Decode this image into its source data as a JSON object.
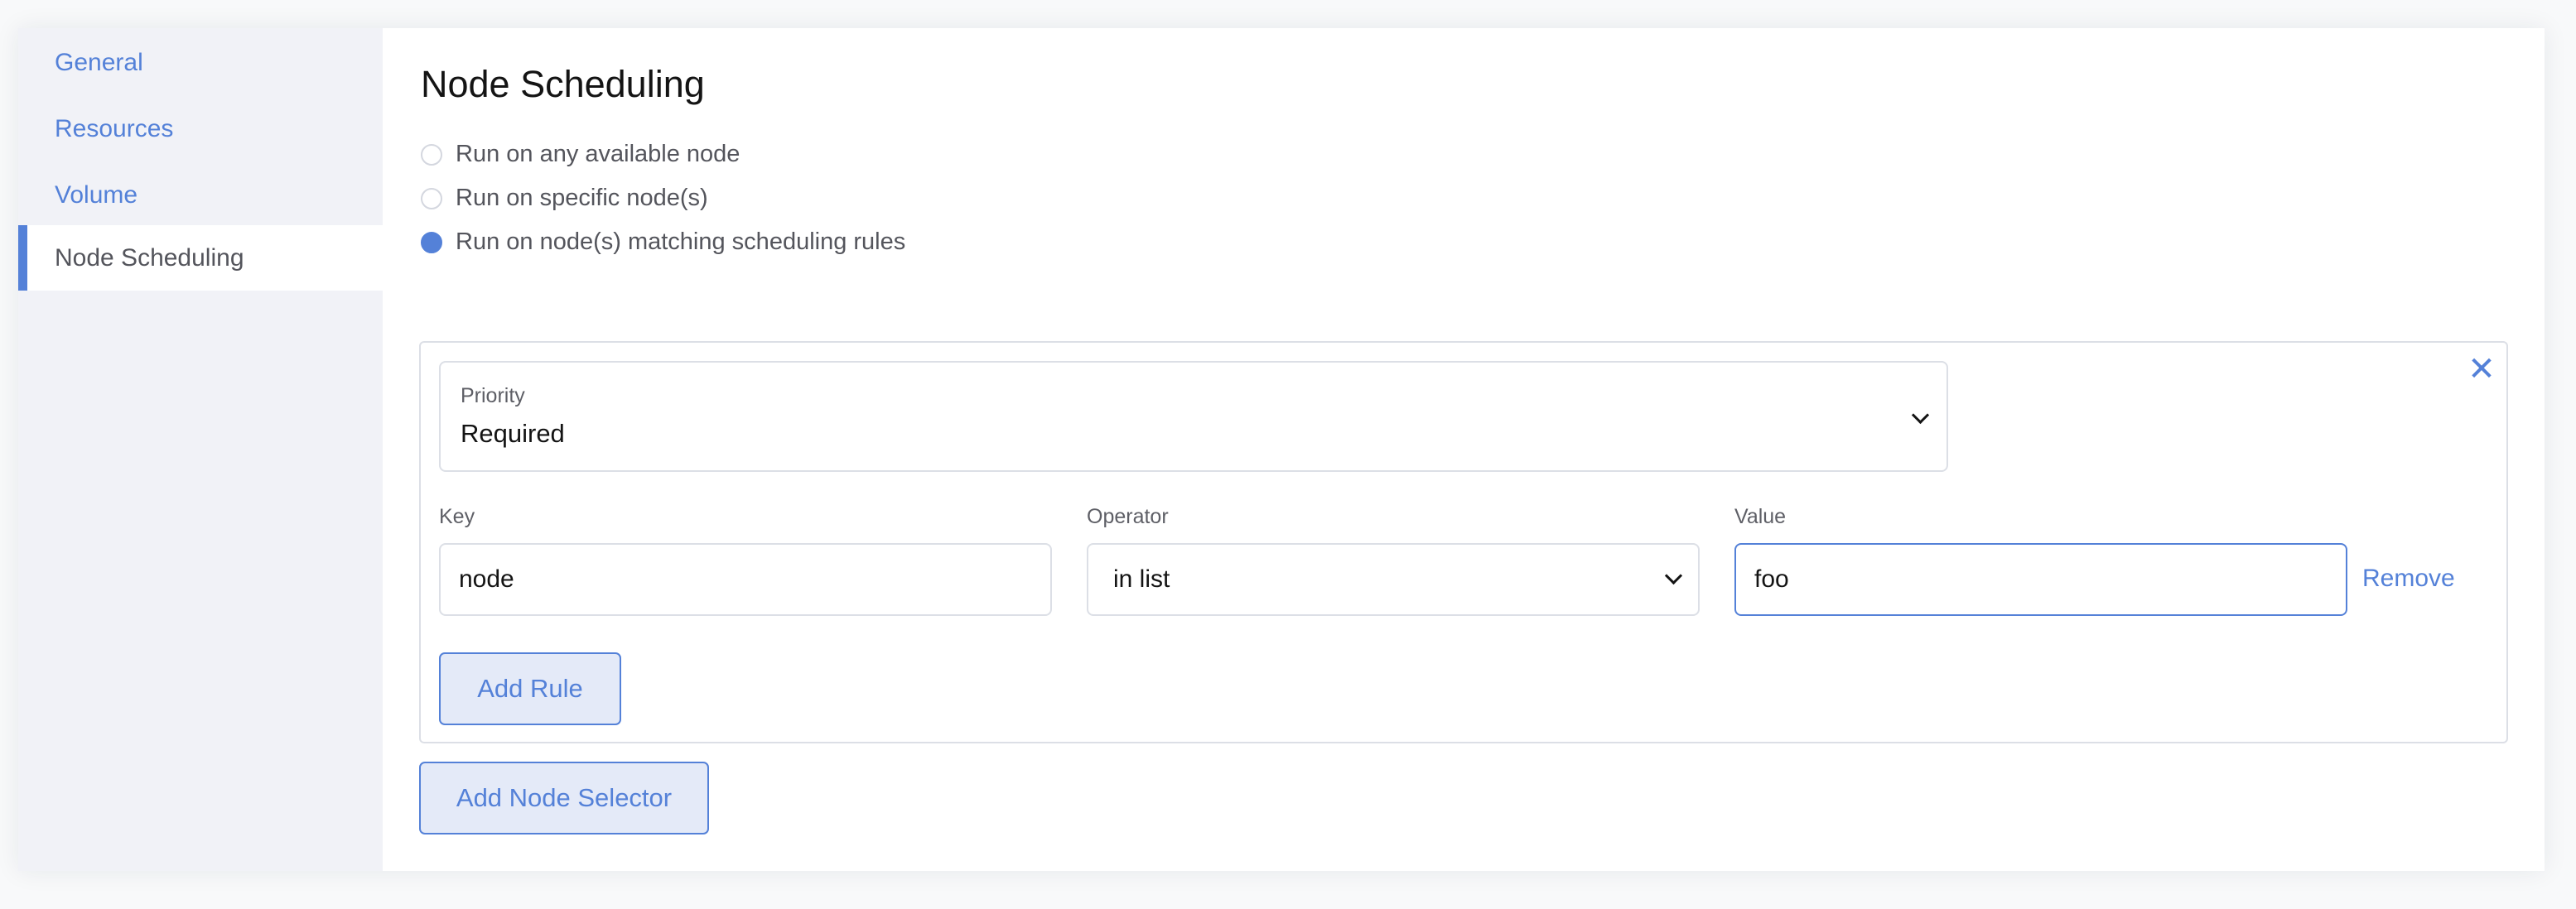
{
  "sidebar": {
    "items": [
      {
        "label": "General",
        "active": false
      },
      {
        "label": "Resources",
        "active": false
      },
      {
        "label": "Volume",
        "active": false
      },
      {
        "label": "Node Scheduling",
        "active": true
      }
    ]
  },
  "main": {
    "title": "Node Scheduling",
    "radio_options": [
      {
        "label": "Run on any available node",
        "checked": false
      },
      {
        "label": "Run on specific node(s)",
        "checked": false
      },
      {
        "label": "Run on node(s) matching scheduling rules",
        "checked": true
      }
    ],
    "selector": {
      "close_icon": "close-icon",
      "priority": {
        "label": "Priority",
        "value": "Required"
      },
      "rule": {
        "key_label": "Key",
        "key_value": "node",
        "operator_label": "Operator",
        "operator_value": "in list",
        "value_label": "Value",
        "value_value": "foo",
        "remove_label": "Remove"
      },
      "add_rule_label": "Add Rule"
    },
    "add_node_selector_label": "Add Node Selector"
  },
  "colors": {
    "accent": "#5481d8",
    "sidebar_bg": "#f1f2f7",
    "button_bg": "#e4eaf8",
    "border": "#dcdfe6",
    "text": "#141414",
    "muted_text": "#5e5f66"
  }
}
